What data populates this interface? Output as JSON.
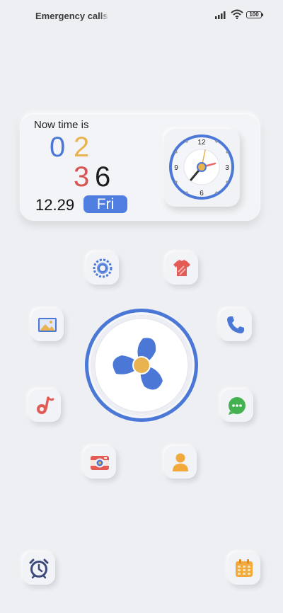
{
  "status_bar": {
    "carrier_text": "Emergency calls only",
    "battery": "100",
    "icons": [
      "signal-icon",
      "wifi-icon",
      "battery-icon"
    ]
  },
  "widget": {
    "label": "Now time is",
    "hour_tens": "0",
    "hour_ones": "2",
    "minute_tens": "3",
    "minute_ones": "6",
    "date": "12.29",
    "day": "Fri",
    "clock_numerals": [
      "12",
      "3",
      "6",
      "9"
    ]
  },
  "apps": [
    {
      "name": "settings-icon"
    },
    {
      "name": "theme-shirt-icon"
    },
    {
      "name": "gallery-icon"
    },
    {
      "name": "phone-icon"
    },
    {
      "name": "fan-cleaner-icon"
    },
    {
      "name": "music-icon"
    },
    {
      "name": "message-icon"
    },
    {
      "name": "camera-icon"
    },
    {
      "name": "contacts-icon"
    },
    {
      "name": "alarm-clock-icon"
    },
    {
      "name": "calendar-icon"
    }
  ],
  "colors": {
    "background": "#eeeff3",
    "blue": "#4b78d7",
    "yellow": "#e9b34f",
    "red": "#d85453",
    "green": "#43b14f"
  }
}
